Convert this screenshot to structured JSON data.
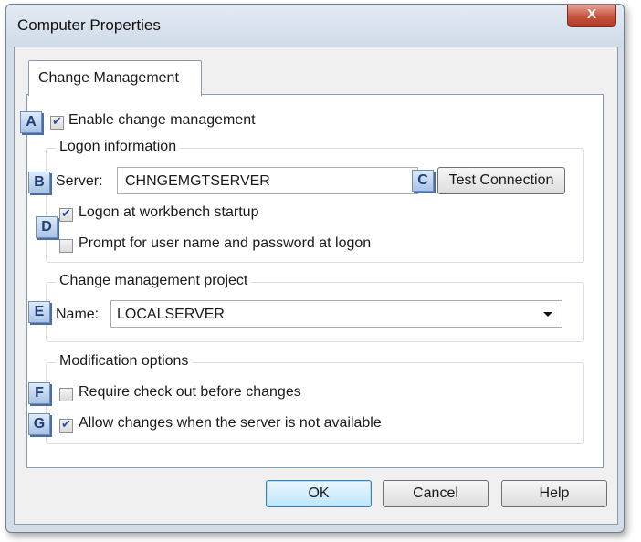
{
  "window": {
    "title": "Computer Properties",
    "close_glyph": "X"
  },
  "tabs": [
    {
      "label": "Change Management",
      "selected": true
    }
  ],
  "markers": {
    "a": "A",
    "b": "B",
    "c": "C",
    "d": "D",
    "e": "E",
    "f": "F",
    "g": "G"
  },
  "enable_change_management": {
    "label": "Enable change management",
    "checked": true
  },
  "logon_group": {
    "legend": "Logon information",
    "server_label": "Server:",
    "server_value": "CHNGEMGTSERVER",
    "test_connection": "Test Connection",
    "logon_at_startup": {
      "label": "Logon at workbench startup",
      "checked": true
    },
    "prompt_credentials": {
      "label": "Prompt for user name and password at logon",
      "checked": false
    }
  },
  "project_group": {
    "legend": "Change management project",
    "name_label": "Name:",
    "name_value": "LOCALSERVER"
  },
  "modification_group": {
    "legend": "Modification options",
    "require_checkout": {
      "label": "Require check out before changes",
      "checked": false
    },
    "allow_offline": {
      "label": "Allow changes when the server is not available",
      "checked": true
    }
  },
  "buttons": {
    "ok": "OK",
    "cancel": "Cancel",
    "help": "Help"
  },
  "colors": {
    "marker_fill": "#a8c3e4",
    "close_button": "#c4533d",
    "default_button_border": "#3c7fb1"
  }
}
